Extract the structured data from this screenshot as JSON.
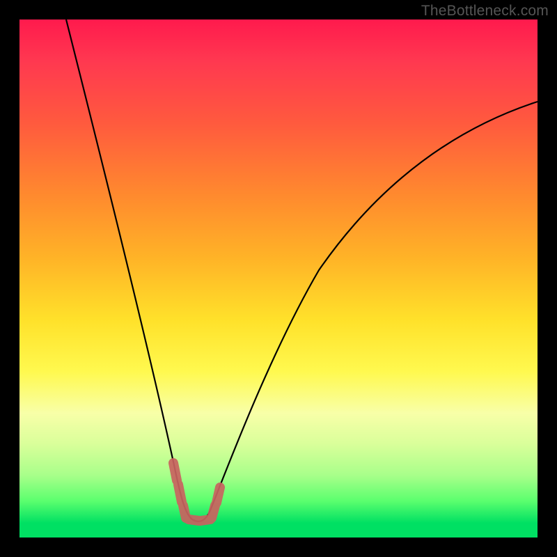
{
  "watermark": "TheBottleneck.com",
  "colors": {
    "frame": "#000000",
    "curve_stroke": "#000000",
    "marker_fill": "#d97a78",
    "marker_stroke": "#c96360"
  },
  "chart_data": {
    "type": "line",
    "title": "",
    "xlabel": "",
    "ylabel": "",
    "xlim": [
      0,
      100
    ],
    "ylim": [
      0,
      100
    ],
    "grid": false,
    "legend": false,
    "note": "Axes are unlabeled; values are estimated from pixel positions as percentages of the plot area. y=0 at bottom (green), y=100 at top (red). The curve is a single V-shaped line with minimum near x≈33, y≈3.",
    "series": [
      {
        "name": "curve",
        "x": [
          9,
          12,
          15,
          18,
          21,
          24,
          27,
          29,
          31,
          33,
          35,
          37,
          40,
          45,
          50,
          55,
          60,
          65,
          70,
          75,
          80,
          85,
          90,
          95,
          100
        ],
        "y": [
          100,
          88,
          76,
          64,
          52,
          41,
          30,
          21,
          12,
          3,
          3,
          6,
          13,
          25,
          35,
          44,
          51,
          57,
          62,
          67,
          71,
          75,
          78,
          81,
          84
        ]
      }
    ],
    "markers": {
      "note": "Short pink segments near the valley floor",
      "points_xy_pct": [
        [
          29.7,
          12.0
        ],
        [
          30.6,
          8.0
        ],
        [
          31.5,
          5.0
        ],
        [
          32.5,
          3.2
        ],
        [
          34.0,
          3.0
        ],
        [
          35.5,
          3.0
        ],
        [
          37.0,
          3.5
        ],
        [
          38.0,
          6.0
        ],
        [
          38.8,
          9.0
        ]
      ]
    }
  }
}
